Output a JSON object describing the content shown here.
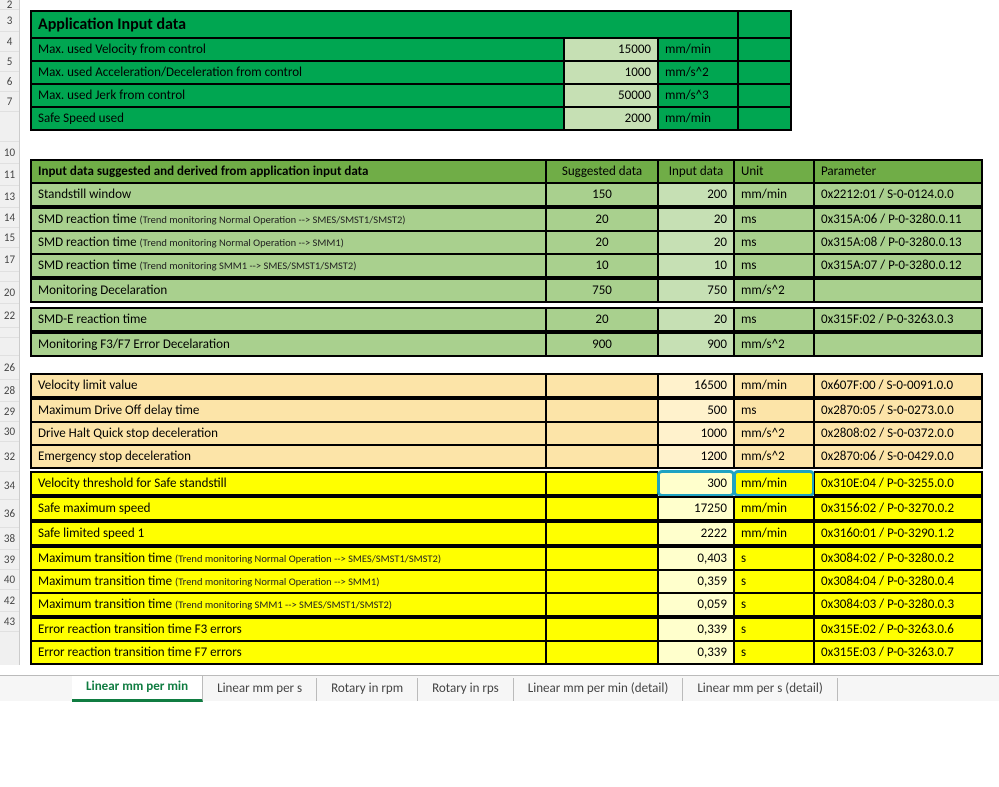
{
  "row_headers": [
    "2",
    "3",
    "4",
    "5",
    "6",
    "7",
    "",
    "10",
    "11",
    "13",
    "14",
    "15",
    "17",
    "",
    "20",
    "22",
    "",
    "",
    "26",
    "28",
    "29",
    "30",
    "32",
    "34",
    "36",
    "38",
    "39",
    "40",
    "42",
    "43"
  ],
  "top": {
    "title": "Application Input data",
    "rows": [
      {
        "label": "Max. used Velocity from control",
        "value": "15000",
        "unit": "mm/min"
      },
      {
        "label": "Max. used Acceleration/Deceleration from control",
        "value": "1000",
        "unit": "mm/s^2"
      },
      {
        "label": "Max. used Jerk from control",
        "value": "50000",
        "unit": "mm/s^3"
      },
      {
        "label": "Safe Speed used",
        "value": "2000",
        "unit": "mm/min"
      }
    ]
  },
  "green": {
    "header": {
      "label": "Input data suggested and derived from application input data",
      "sugg": "Suggested data",
      "input": "Input data",
      "unit": "Unit",
      "param": "Parameter"
    },
    "standstill": {
      "label": "Standstill window",
      "sugg": "150",
      "input": "200",
      "unit": "mm/min",
      "param": "0x2212:01 / S-0-0124.0.0"
    },
    "smd": [
      {
        "label": "SMD reaction time ",
        "note": "(Trend monitoring Normal Operation --> SMES/SMST1/SMST2)",
        "sugg": "20",
        "input": "20",
        "unit": "ms",
        "param": "0x315A:06 / P-0-3280.0.11"
      },
      {
        "label": "SMD reaction time ",
        "note": "(Trend monitoring Normal Operation --> SMM1)",
        "sugg": "20",
        "input": "20",
        "unit": "ms",
        "param": "0x315A:08 / P-0-3280.0.13"
      },
      {
        "label": "SMD reaction time ",
        "note": "(Trend monitoring SMM1 --> SMES/SMST1/SMST2)",
        "sugg": "10",
        "input": "10",
        "unit": "ms",
        "param": "0x315A:07 / P-0-3280.0.12"
      }
    ],
    "mondec": {
      "label": "Monitoring Decelaration",
      "sugg": "750",
      "input": "750",
      "unit": "mm/s^2",
      "param": ""
    },
    "smde": {
      "label": "SMD-E reaction time",
      "sugg": "20",
      "input": "20",
      "unit": "ms",
      "param": "0x315F:02 / P-0-3263.0.3"
    },
    "monf3": {
      "label": "Monitoring F3/F7 Error Decelaration",
      "sugg": "900",
      "input": "900",
      "unit": "mm/s^2",
      "param": ""
    }
  },
  "tan": {
    "vlv": {
      "label": "Velocity limit value",
      "input": "16500",
      "unit": "mm/min",
      "param": "0x607F:00 / S-0-0091.0.0"
    },
    "rows": [
      {
        "label": "Maximum Drive Off delay time",
        "input": "500",
        "unit": "ms",
        "param": "0x2870:05 / S-0-0273.0.0"
      },
      {
        "label": "Drive Halt Quick stop deceleration",
        "input": "1000",
        "unit": "mm/s^2",
        "param": "0x2808:02 / S-0-0372.0.0"
      },
      {
        "label": "Emergency stop deceleration",
        "input": "1200",
        "unit": "mm/s^2",
        "param": "0x2870:06 / S-0-0429.0.0"
      }
    ]
  },
  "yellow": {
    "vtss": {
      "label": "Velocity threshold for Safe standstill",
      "input": "300",
      "unit": "mm/min",
      "param": "0x310E:04 / P-0-3255.0.0"
    },
    "sms": {
      "label": "Safe maximum speed",
      "input": "17250",
      "unit": "mm/min",
      "param": "0x3156:02 / P-0-3270.0.2"
    },
    "sls": {
      "label": "Safe limited speed 1",
      "input": "2222",
      "unit": "mm/min",
      "param": "0x3160:01 / P-0-3290.1.2"
    },
    "mtt": [
      {
        "label": "Maximum transition time ",
        "note": "(Trend monitoring Normal Operation --> SMES/SMST1/SMST2)",
        "input": "0,403",
        "unit": "s",
        "param": "0x3084:02 / P-0-3280.0.2"
      },
      {
        "label": "Maximum transition time ",
        "note": "(Trend monitoring Normal Operation --> SMM1)",
        "input": "0,359",
        "unit": "s",
        "param": "0x3084:04 / P-0-3280.0.4"
      },
      {
        "label": "Maximum transition time ",
        "note": "(Trend monitoring SMM1 --> SMES/SMST1/SMST2)",
        "input": "0,059",
        "unit": "s",
        "param": "0x3084:03 / P-0-3280.0.3"
      }
    ],
    "err": [
      {
        "label": "Error reaction transition time F3 errors",
        "input": "0,339",
        "unit": "s",
        "param": "0x315E:02 / P-0-3263.0.6"
      },
      {
        "label": "Error reaction transition time F7 errors",
        "input": "0,339",
        "unit": "s",
        "param": "0x315E:03 / P-0-3263.0.7"
      }
    ]
  },
  "tabs": {
    "items": [
      "Linear mm per min",
      "Linear mm per s",
      "Rotary in rpm",
      "Rotary in rps",
      "Linear mm per min (detail)",
      "Linear mm per s (detail)"
    ],
    "active_index": 0
  }
}
